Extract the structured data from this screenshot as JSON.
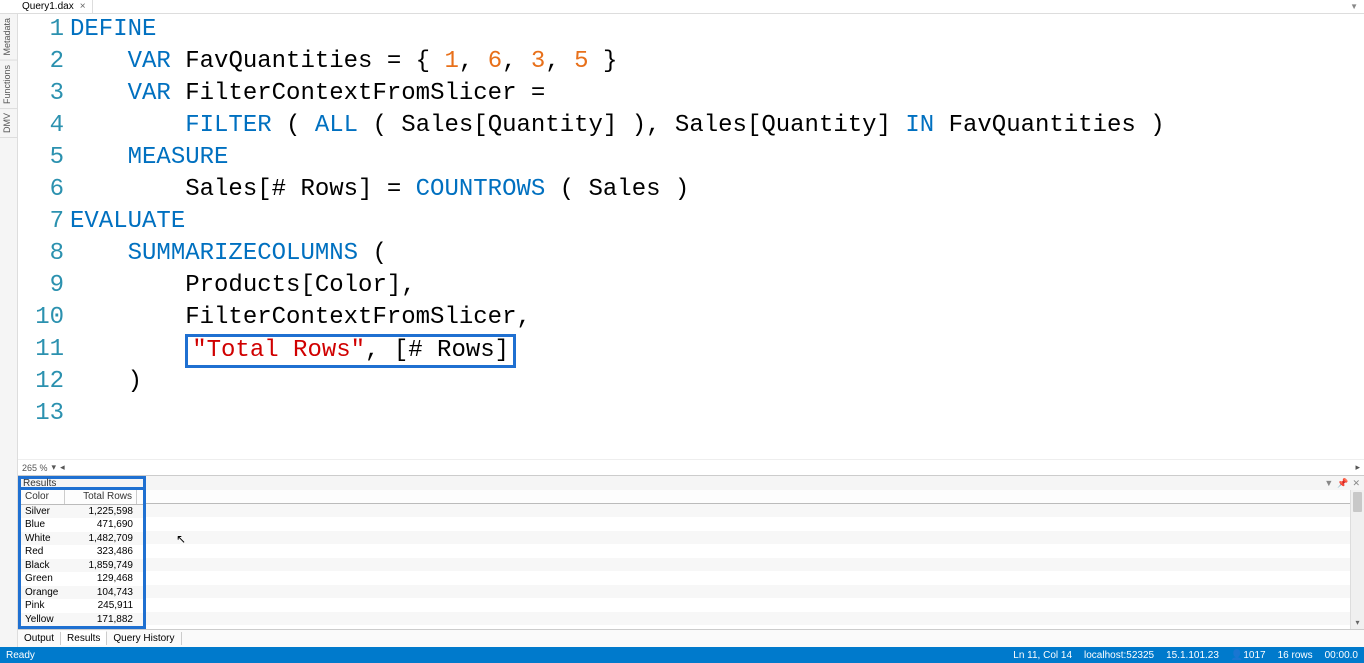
{
  "tab": {
    "filename": "Query1.dax"
  },
  "side_tabs": [
    "Metadata",
    "Functions",
    "DMV"
  ],
  "zoom": {
    "level": "265 %"
  },
  "code": {
    "lines": [
      {
        "n": 1,
        "tokens": [
          {
            "t": "DEFINE",
            "c": "kw"
          }
        ]
      },
      {
        "n": 2,
        "tokens": [
          {
            "t": "    "
          },
          {
            "t": "VAR",
            "c": "kw"
          },
          {
            "t": " FavQuantities = { "
          },
          {
            "t": "1",
            "c": "num"
          },
          {
            "t": ", "
          },
          {
            "t": "6",
            "c": "num"
          },
          {
            "t": ", "
          },
          {
            "t": "3",
            "c": "num"
          },
          {
            "t": ", "
          },
          {
            "t": "5",
            "c": "num"
          },
          {
            "t": " }"
          }
        ]
      },
      {
        "n": 3,
        "tokens": [
          {
            "t": "    "
          },
          {
            "t": "VAR",
            "c": "kw"
          },
          {
            "t": " FilterContextFromSlicer ="
          }
        ]
      },
      {
        "n": 4,
        "tokens": [
          {
            "t": "        "
          },
          {
            "t": "FILTER",
            "c": "fn"
          },
          {
            "t": " ( "
          },
          {
            "t": "ALL",
            "c": "fn"
          },
          {
            "t": " ( Sales[Quantity] ), Sales[Quantity] "
          },
          {
            "t": "IN",
            "c": "kw"
          },
          {
            "t": " FavQuantities )"
          }
        ]
      },
      {
        "n": 5,
        "tokens": [
          {
            "t": "    "
          },
          {
            "t": "MEASURE",
            "c": "kw"
          }
        ]
      },
      {
        "n": 6,
        "tokens": [
          {
            "t": "        Sales[# Rows] = "
          },
          {
            "t": "COUNTROWS",
            "c": "fn"
          },
          {
            "t": " ( Sales )"
          }
        ]
      },
      {
        "n": 7,
        "tokens": [
          {
            "t": "EVALUATE",
            "c": "kw"
          }
        ]
      },
      {
        "n": 8,
        "tokens": [
          {
            "t": "    "
          },
          {
            "t": "SUMMARIZECOLUMNS",
            "c": "fn"
          },
          {
            "t": " ("
          }
        ]
      },
      {
        "n": 9,
        "tokens": [
          {
            "t": "        Products[Color],"
          }
        ]
      },
      {
        "n": 10,
        "tokens": [
          {
            "t": "        FilterContextFromSlicer,"
          }
        ]
      },
      {
        "n": 11,
        "tokens": [
          {
            "t": "        "
          }
        ],
        "boxed": [
          {
            "t": "\"Total Rows\"",
            "c": "str"
          },
          {
            "t": ", [# Rows]"
          }
        ]
      },
      {
        "n": 12,
        "tokens": [
          {
            "t": "    )"
          }
        ]
      },
      {
        "n": 13,
        "tokens": []
      }
    ]
  },
  "results": {
    "title": "Results",
    "columns": [
      "Color",
      "Total Rows"
    ],
    "rows": [
      [
        "Silver",
        "1,225,598"
      ],
      [
        "Blue",
        "471,690"
      ],
      [
        "White",
        "1,482,709"
      ],
      [
        "Red",
        "323,486"
      ],
      [
        "Black",
        "1,859,749"
      ],
      [
        "Green",
        "129,468"
      ],
      [
        "Orange",
        "104,743"
      ],
      [
        "Pink",
        "245,911"
      ],
      [
        "Yellow",
        "171,882"
      ]
    ]
  },
  "bottom_tabs": {
    "items": [
      "Output",
      "Results",
      "Query History"
    ],
    "active": 1
  },
  "status": {
    "ready": "Ready",
    "cursor": "Ln 11, Col 14",
    "host": "localhost:52325",
    "version": "15.1.101.23",
    "user_icon": "👤",
    "user_count": "1017",
    "rows": "16 rows",
    "time": "00:00.0"
  }
}
